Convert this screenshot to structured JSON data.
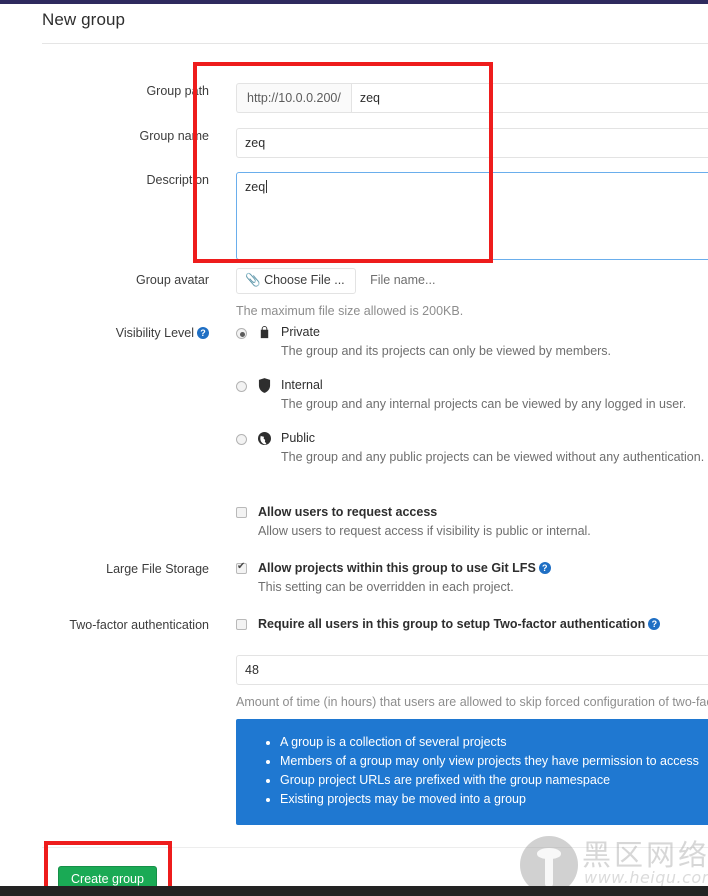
{
  "page": {
    "title": "New group"
  },
  "form": {
    "group_path": {
      "label": "Group path",
      "prefix": "http://10.0.0.200/",
      "value": "zeq"
    },
    "group_name": {
      "label": "Group name",
      "value": "zeq"
    },
    "description": {
      "label": "Description",
      "value": "zeq"
    },
    "group_avatar": {
      "label": "Group avatar",
      "choose_button": "Choose File ...",
      "file_name": "File name...",
      "help": "The maximum file size allowed is 200KB.",
      "paperclip_icon": "paperclip-icon"
    },
    "visibility": {
      "label": "Visibility Level",
      "help_icon": "question-mark-icon",
      "selected": "private",
      "options": [
        {
          "id": "private",
          "icon": "lock-icon",
          "title": "Private",
          "description": "The group and its projects can only be viewed by members.",
          "checked": true
        },
        {
          "id": "internal",
          "icon": "shield-icon",
          "title": "Internal",
          "description": "The group and any internal projects can be viewed by any logged in user.",
          "checked": false
        },
        {
          "id": "public",
          "icon": "globe-icon",
          "title": "Public",
          "description": "The group and any public projects can be viewed without any authentication.",
          "checked": false
        }
      ]
    },
    "request_access": {
      "label": "Allow users to request access",
      "description": "Allow users to request access if visibility is public or internal.",
      "checked": false
    },
    "lfs": {
      "label": "Large File Storage",
      "checkbox_label": "Allow projects within this group to use Git LFS",
      "description": "This setting can be overridden in each project.",
      "checked": true,
      "help_icon": "question-mark-icon"
    },
    "two_factor": {
      "label": "Two-factor authentication",
      "checkbox_label": "Require all users in this group to setup Two-factor authentication",
      "checked": false,
      "help_icon": "question-mark-icon",
      "grace_period_value": "48",
      "grace_period_help": "Amount of time (in hours) that users are allowed to skip forced configuration of two-fact"
    },
    "info_box": {
      "items": [
        "A group is a collection of several projects",
        "Members of a group may only view projects they have permission to access",
        "Group project URLs are prefixed with the group namespace",
        "Existing projects may be moved into a group"
      ]
    },
    "submit": {
      "label": "Create group"
    }
  },
  "watermark": {
    "cn_text": "黑区网络",
    "url_text": "www.heiqu.com"
  },
  "colors": {
    "navbar": "#2e2a5e",
    "annotation": "#ee1c1c",
    "info_box": "#1f78d1",
    "submit_button": "#1aaa55",
    "focus_border": "#6aaeec"
  }
}
